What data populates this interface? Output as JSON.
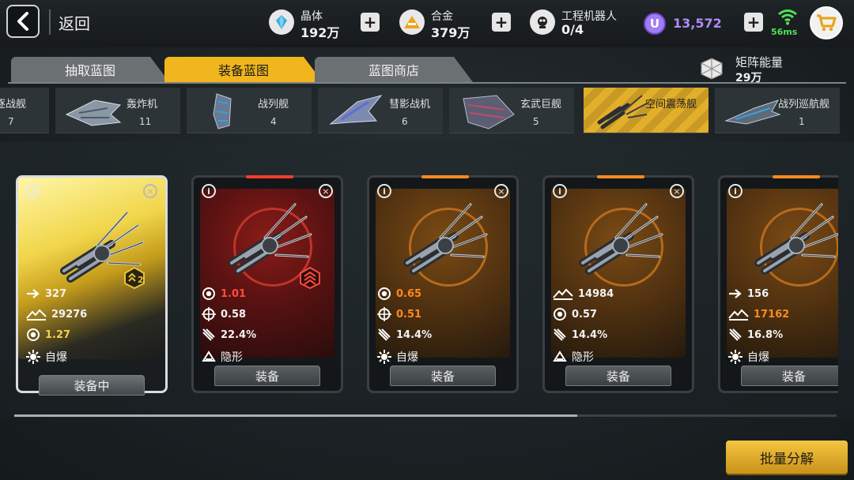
{
  "header": {
    "back_label": "返回",
    "resources": [
      {
        "name": "crystal",
        "label": "晶体",
        "value": "192万"
      },
      {
        "name": "alloy",
        "label": "合金",
        "value": "379万"
      },
      {
        "name": "engineering-robots",
        "label": "工程机器人",
        "value": "0/4"
      }
    ],
    "premium_value": "13,572",
    "premium_icon_letter": "U",
    "ping": "56ms"
  },
  "tabs": [
    {
      "label": "抽取蓝图",
      "active": false
    },
    {
      "label": "装备蓝图",
      "active": true
    },
    {
      "label": "蓝图商店",
      "active": false
    }
  ],
  "matrix": {
    "label": "矩阵能量",
    "value": "29万"
  },
  "ship_types": [
    {
      "name": "驱逐战舰",
      "count": "7",
      "visible_name": "逐战舰",
      "active": false
    },
    {
      "name": "轰炸机",
      "count": "11",
      "active": false
    },
    {
      "name": "战列舰",
      "count": "4",
      "active": false
    },
    {
      "name": "彗影战机",
      "count": "6",
      "active": false
    },
    {
      "name": "玄武巨舰",
      "count": "5",
      "active": false
    },
    {
      "name": "空间震荡舰",
      "count": "",
      "active": true
    },
    {
      "name": "战列巡航舰",
      "count": "1",
      "active": false
    }
  ],
  "cards": [
    {
      "theme": "equipped",
      "rank": "2",
      "stats": [
        {
          "icon": "speed-icon",
          "value": "327",
          "color": "#f3f3f3"
        },
        {
          "icon": "hull-icon",
          "value": "29276",
          "color": "#f3f3f3"
        },
        {
          "icon": "rate-icon",
          "value": "1.27",
          "color": "#f3d24a"
        }
      ],
      "tag": "自爆",
      "tag_icon": "self-destruct-icon",
      "button": "装备中"
    },
    {
      "theme": "red",
      "rank": "chevrons",
      "stats": [
        {
          "icon": "rate-icon",
          "value": "1.01",
          "color": "#ff4a3a"
        },
        {
          "icon": "crosshair-icon",
          "value": "0.58",
          "color": "#f3f3f3"
        },
        {
          "icon": "missile-icon",
          "value": "22.4%",
          "color": "#f3f3f3"
        }
      ],
      "tag": "隐形",
      "tag_icon": "stealth-icon",
      "button": "装备"
    },
    {
      "theme": "orange",
      "stats": [
        {
          "icon": "rate-icon",
          "value": "0.65",
          "color": "#ff8a1e"
        },
        {
          "icon": "crosshair-icon",
          "value": "0.51",
          "color": "#ff8a1e"
        },
        {
          "icon": "missile-icon",
          "value": "14.4%",
          "color": "#f3f3f3"
        }
      ],
      "tag": "自爆",
      "tag_icon": "self-destruct-icon",
      "button": "装备"
    },
    {
      "theme": "orange",
      "stats": [
        {
          "icon": "hull-icon",
          "value": "14984",
          "color": "#f3f3f3"
        },
        {
          "icon": "rate-icon",
          "value": "0.57",
          "color": "#f3f3f3"
        },
        {
          "icon": "missile-icon",
          "value": "14.4%",
          "color": "#f3f3f3"
        }
      ],
      "tag": "隐形",
      "tag_icon": "stealth-icon",
      "button": "装备"
    },
    {
      "theme": "orange",
      "stats": [
        {
          "icon": "speed-icon",
          "value": "156",
          "color": "#f3f3f3"
        },
        {
          "icon": "hull-icon",
          "value": "17162",
          "color": "#ff8a1e"
        },
        {
          "icon": "missile-icon",
          "value": "16.8%",
          "color": "#f3f3f3"
        }
      ],
      "tag": "自爆",
      "tag_icon": "self-destruct-icon",
      "button": "装备"
    }
  ],
  "bulk_button": "批量分解",
  "colors": {
    "accent": "#f1b61d",
    "red_card": "#7a1a1a",
    "orange_card": "#6a4012",
    "premium": "#b08af7",
    "ping": "#53e05a"
  }
}
